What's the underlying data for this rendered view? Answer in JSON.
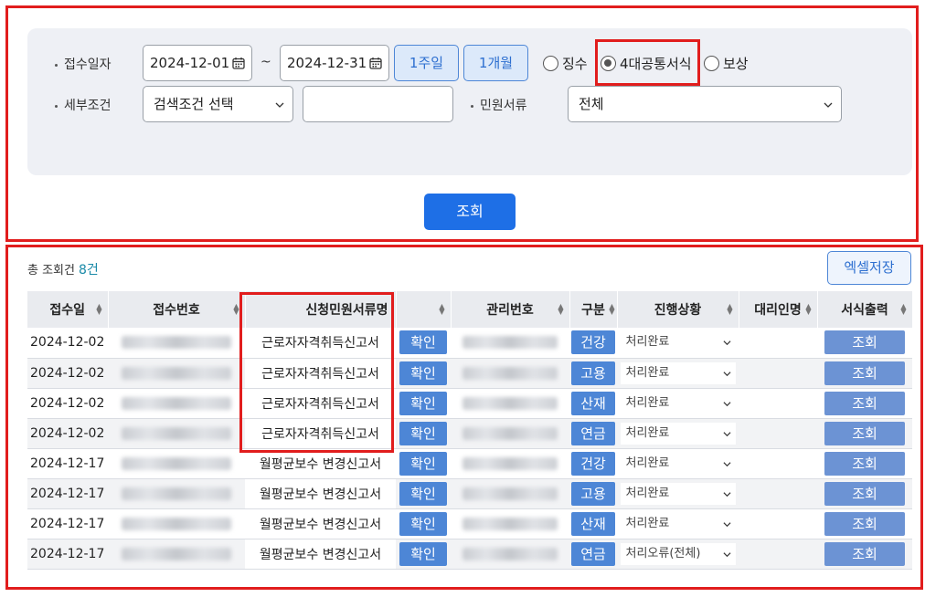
{
  "search": {
    "date_label": "접수일자",
    "date_from": "2024-12-01",
    "date_tilde": "~",
    "date_to": "2024-12-31",
    "week_btn": "1주일",
    "month_btn": "1개월",
    "radios": [
      {
        "label": "징수",
        "checked": false
      },
      {
        "label": "4대공통서식",
        "checked": true
      },
      {
        "label": "보상",
        "checked": false
      }
    ],
    "detail_label": "세부조건",
    "detail_select": "검색조건 선택",
    "detail_input": "",
    "doc_label": "민원서류",
    "doc_select": "전체",
    "search_btn": "조회"
  },
  "results": {
    "total_label": "총 조회건",
    "total_count": "8건",
    "excel_btn": "엑셀저장",
    "columns": [
      "접수일",
      "접수번호",
      "신청민원서류명",
      "",
      "관리번호",
      "구분",
      "진행상황",
      "대리인명",
      "서식출력"
    ],
    "rows": [
      {
        "date": "2024-12-02",
        "doc": "근로자자격취득신고서",
        "confirm": "확인",
        "type": "건강",
        "status": "처리완료",
        "agent": "",
        "print": "조회"
      },
      {
        "date": "2024-12-02",
        "doc": "근로자자격취득신고서",
        "confirm": "확인",
        "type": "고용",
        "status": "처리완료",
        "agent": "",
        "print": "조회"
      },
      {
        "date": "2024-12-02",
        "doc": "근로자자격취득신고서",
        "confirm": "확인",
        "type": "산재",
        "status": "처리완료",
        "agent": "",
        "print": "조회"
      },
      {
        "date": "2024-12-02",
        "doc": "근로자자격취득신고서",
        "confirm": "확인",
        "type": "연금",
        "status": "처리완료",
        "agent": "",
        "print": "조회"
      },
      {
        "date": "2024-12-17",
        "doc": "월평균보수 변경신고서",
        "confirm": "확인",
        "type": "건강",
        "status": "처리완료",
        "agent": "",
        "print": "조회"
      },
      {
        "date": "2024-12-17",
        "doc": "월평균보수 변경신고서",
        "confirm": "확인",
        "type": "고용",
        "status": "처리완료",
        "agent": "",
        "print": "조회"
      },
      {
        "date": "2024-12-17",
        "doc": "월평균보수 변경신고서",
        "confirm": "확인",
        "type": "산재",
        "status": "처리완료",
        "agent": "",
        "print": "조회"
      },
      {
        "date": "2024-12-17",
        "doc": "월평균보수 변경신고서",
        "confirm": "확인",
        "type": "연금",
        "status": "처리오류(전체)",
        "agent": "",
        "print": "조회"
      }
    ]
  },
  "colors": {
    "primary": "#1e6fe6",
    "accent": "#4d86d6",
    "annotation": "#e11d1d"
  }
}
